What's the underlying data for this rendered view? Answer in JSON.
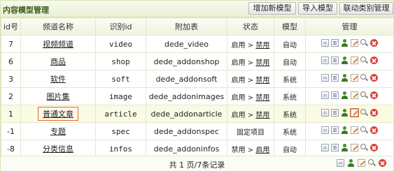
{
  "title": "内容模型管理",
  "buttons": {
    "add": "增加新模型",
    "import": "导入模型",
    "link": "联动类别管理"
  },
  "columns": [
    "id号",
    "频道名称",
    "识别id",
    "附加表",
    "状态",
    "模型",
    "管理"
  ],
  "rows": [
    {
      "id": "7",
      "name": "视频频道",
      "nid": "video",
      "table": "dede_video",
      "status": "启用 > ",
      "status_link": "禁用",
      "type": "自动"
    },
    {
      "id": "6",
      "name": "商品",
      "nid": "shop",
      "table": "dede_addonshop",
      "status": "启用 > ",
      "status_link": "禁用",
      "type": "自动"
    },
    {
      "id": "3",
      "name": "软件",
      "nid": "soft",
      "table": "dede_addonsoft",
      "status": "启用 > ",
      "status_link": "禁用",
      "type": "系统"
    },
    {
      "id": "2",
      "name": "图片集",
      "nid": "image",
      "table": "dede_addonimages",
      "status": "启用 > ",
      "status_link": "禁用",
      "type": "系统"
    },
    {
      "id": "1",
      "name": "普通文章",
      "nid": "article",
      "table": "dede_addonarticle",
      "status": "启用 > ",
      "status_link": "禁用",
      "type": "系统"
    },
    {
      "id": "-1",
      "name": "专题",
      "nid": "spec",
      "table": "dede_addonspec",
      "status": "固定项目",
      "status_link": "",
      "type": "系统"
    },
    {
      "id": "-8",
      "name": "分类信息",
      "nid": "infos",
      "table": "dede_addoninfos",
      "status": "禁用 > ",
      "status_link": "启用",
      "type": "自动"
    }
  ],
  "footer": "共 1 页/7条记录",
  "icons": [
    "page-icon",
    "list-icon",
    "user-icon",
    "edit-icon",
    "zoom-icon",
    "delete-icon"
  ]
}
